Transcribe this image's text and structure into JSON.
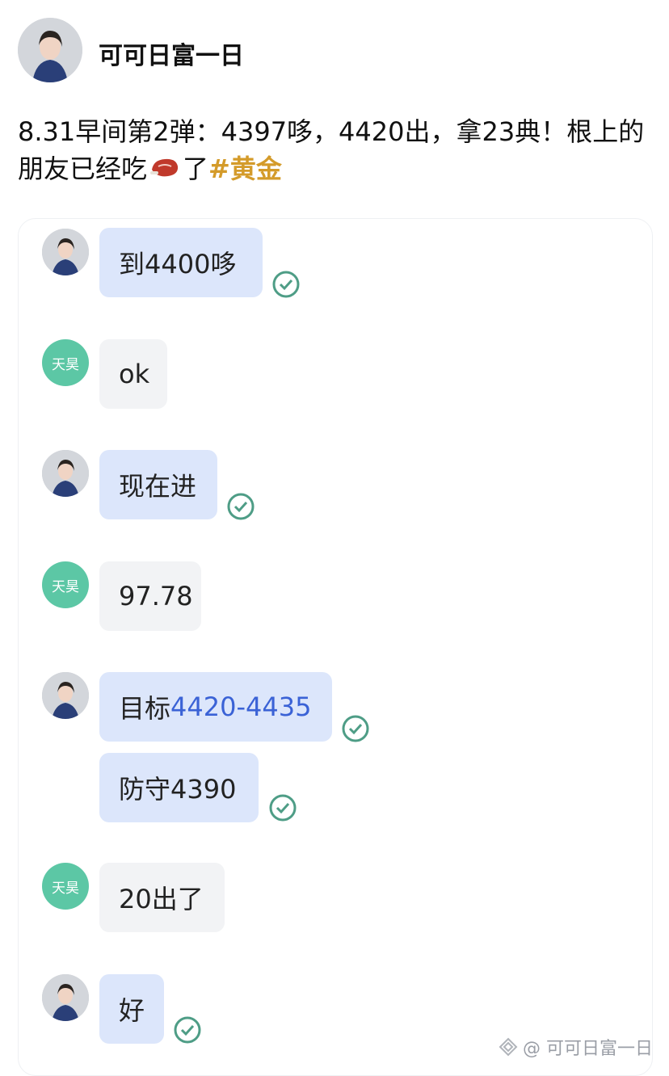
{
  "post": {
    "username": "可可日富一日",
    "text_part1": "8.31早间第2弹：4397哆，4420出，拿23典！根上的朋友已经吃",
    "text_part2": "了",
    "hashtag": "#黄金",
    "emoji_icon": "steak-icon"
  },
  "chat": {
    "messages": [
      {
        "sender": "self",
        "text": "到4400哆",
        "read": true
      },
      {
        "sender": "other",
        "avatar_text": "天昊",
        "text": "ok"
      },
      {
        "sender": "self",
        "text": "现在进",
        "read": true
      },
      {
        "sender": "other",
        "avatar_text": "天昊",
        "text": "97.78"
      },
      {
        "sender": "self",
        "text_prefix": "目标",
        "text_highlight": "4420-4435",
        "read": true
      },
      {
        "sender": "self",
        "text": "防守4390",
        "read": true
      },
      {
        "sender": "other",
        "avatar_text": "天昊",
        "text": "20出了"
      },
      {
        "sender": "self",
        "text": "好",
        "read": true
      }
    ]
  },
  "watermark": {
    "text": "@ 可可日富一日"
  },
  "colors": {
    "self_bubble": "#dce6fb",
    "other_bubble": "#f2f3f5",
    "check": "#4e9d86",
    "hashtag": "#d49b2a",
    "link": "#3a62d6"
  }
}
